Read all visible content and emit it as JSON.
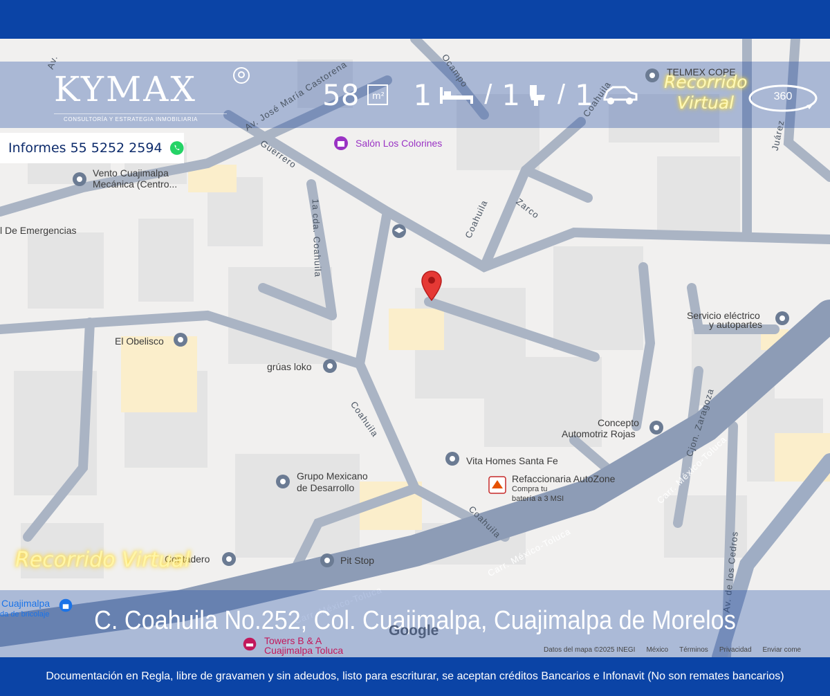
{
  "brand": {
    "name": "KYMAX",
    "tagline": "CONSULTORÍA Y ESTRATEGIA INMOBILIARIA"
  },
  "stats": {
    "area": "58",
    "bedrooms": "1",
    "bathrooms": "1",
    "parking": "1",
    "separator": "/"
  },
  "tour": {
    "top_line1": "Recorrido",
    "top_line2": "Virtual",
    "badge": "360",
    "bottom": "Recorrido Virtual"
  },
  "contact": {
    "text": "Informes 55 5252 2594"
  },
  "address": "C. Coahuila No.252, Col. Cuajimalpa, Cuajimalpa de Morelos",
  "footer": "Documentación en Regla, libre de gravamen y sin adeudos, listo para escriturar, se aceptan créditos Bancarios e Infonavit (No son remates bancarios)",
  "map": {
    "places": {
      "telmex": "TELMEX COPE",
      "salon": "Salón Los Colorines",
      "vento_1": "Vento Cuajimalpa",
      "vento_2": "Mecánica (Centro...",
      "emergencias": "l De Emergencias",
      "obelisco": "El Obelisco",
      "gruas": "grúas loko",
      "servicio_1": "Servicio eléctrico",
      "servicio_2": "y autopartes",
      "concepto_1": "Concepto",
      "concepto_2": "Automotriz Rojas",
      "vita": "Vita Homes Santa Fe",
      "autozone": "Refaccionaria AutoZone",
      "autozone_sub1": "Compra tu",
      "autozone_sub2": "batería a 3 MSI",
      "grupo_1": "Grupo Mexicano",
      "grupo_2": "de Desarrollo",
      "contadero": "Contadero",
      "pitstop": "Pit Stop",
      "cuajimalpa": "Cuajimalpa",
      "bricolaje": "da de bricolaje",
      "towers_1": "Towers B & A",
      "towers_2": "Cuajimalpa Toluca"
    },
    "streets": {
      "castorena": "Av. José María Castorena",
      "guerrero": "Guerrero",
      "ocampo": "Ocampo",
      "coahuila_top": "Coahuila",
      "coahuila_mid": "Coahuila",
      "coahuila_a": "Coahuila",
      "coahuila_b": "Coahuila",
      "cda_coahuila": "1a cda. Coahuila",
      "zarco": "Zarco",
      "juarez": "Juárez",
      "zaragoza": "Cjon. Zaragoza",
      "mex_toluca_1": "Carr. México-Toluca",
      "mex_toluca_2": "Carr. México-Toluca",
      "mex_toluca_3": "Carr. México-Toluca",
      "cedros": "Av. de los Cedros",
      "av_top": "Av."
    },
    "google": "Google",
    "attribution": [
      "Datos del mapa ©2025 INEGI",
      "México",
      "Términos",
      "Privacidad",
      "Enviar come"
    ]
  },
  "colors": {
    "bar_blue": "#0b44a6",
    "road": "#aab4c4",
    "highway": "#8d9cb6",
    "block": "#e3e3e3",
    "pin_red": "#e53935"
  }
}
